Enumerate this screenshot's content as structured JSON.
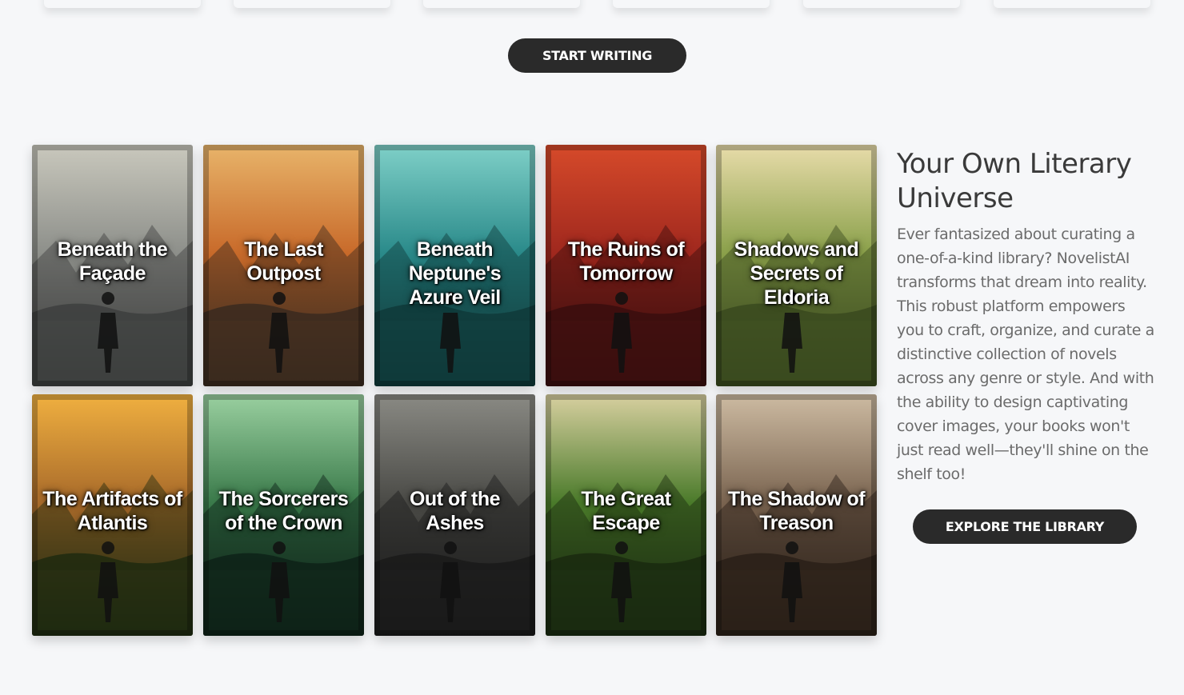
{
  "buttons": {
    "start_writing": "START WRITING",
    "explore_library": "EXPLORE THE LIBRARY"
  },
  "books": [
    {
      "title": "Beneath the Façade",
      "palette": [
        "#3d3f3e",
        "#8d8f8a",
        "#c9c8bd"
      ]
    },
    {
      "title": "The Last Outpost",
      "palette": [
        "#3a2a1e",
        "#c86a2a",
        "#e8b46a"
      ]
    },
    {
      "title": "Beneath Neptune's Azure Veil",
      "palette": [
        "#0f3a3a",
        "#2a8a8a",
        "#7fd0c8"
      ]
    },
    {
      "title": "The Ruins of Tomorrow",
      "palette": [
        "#3a0e0e",
        "#a0281e",
        "#d64a2a"
      ]
    },
    {
      "title": "Shadows and Secrets of Eldoria",
      "palette": [
        "#3a4a1e",
        "#8aa04a",
        "#e8dcaa"
      ]
    },
    {
      "title": "The Artifacts of Atlantis",
      "palette": [
        "#1e2a10",
        "#a86a2a",
        "#f0b040"
      ]
    },
    {
      "title": "The Sorcerers of the Crown",
      "palette": [
        "#0e2218",
        "#3a7a4a",
        "#9ad0a0"
      ]
    },
    {
      "title": "Out of the Ashes",
      "palette": [
        "#1a1a1a",
        "#4a4a46",
        "#8a8a84"
      ]
    },
    {
      "title": "The Great Escape",
      "palette": [
        "#1a2a10",
        "#4a7a2a",
        "#d8d0a0"
      ]
    },
    {
      "title": "The Shadow of Treason",
      "palette": [
        "#2a2018",
        "#7a6450",
        "#cdbba2"
      ]
    }
  ],
  "side": {
    "heading": "Your Own Literary Universe",
    "body": "Ever fantasized about curating a one-of-a-kind library? NovelistAI transforms that dream into reality. This robust platform empowers you to craft, organize, and curate a distinctive collection of novels across any genre or style. And with the ability to design captivating cover images, your books won't just read well—they'll shine on the shelf too!"
  }
}
